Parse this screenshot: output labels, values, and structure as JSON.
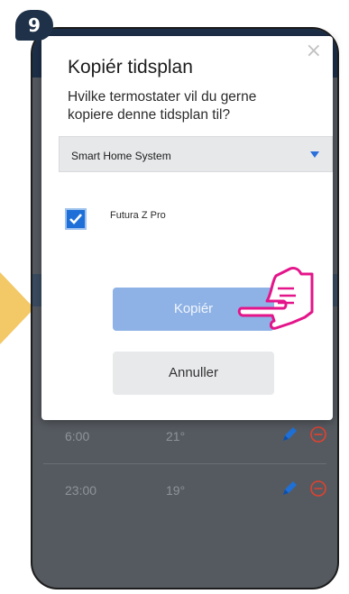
{
  "step": {
    "number": "9"
  },
  "dialog": {
    "close": "×",
    "title": "Kopiér tidsplan",
    "subtitle": "Hvilke termostater vil du gerne kopiere denne tidsplan til?",
    "select": {
      "value": "Smart Home System"
    },
    "options": [
      {
        "label": "Futura Z Pro",
        "checked": true
      }
    ],
    "copy_label": "Kopiér",
    "cancel_label": "Annuller"
  },
  "schedule": [
    {
      "time": "6:00",
      "temp": "21°"
    },
    {
      "time": "23:00",
      "temp": "19°"
    }
  ],
  "colors": {
    "accent": "#1e70d8",
    "header": "#1d2f48",
    "arrow": "#f3c866",
    "hand": "#e4148a"
  }
}
